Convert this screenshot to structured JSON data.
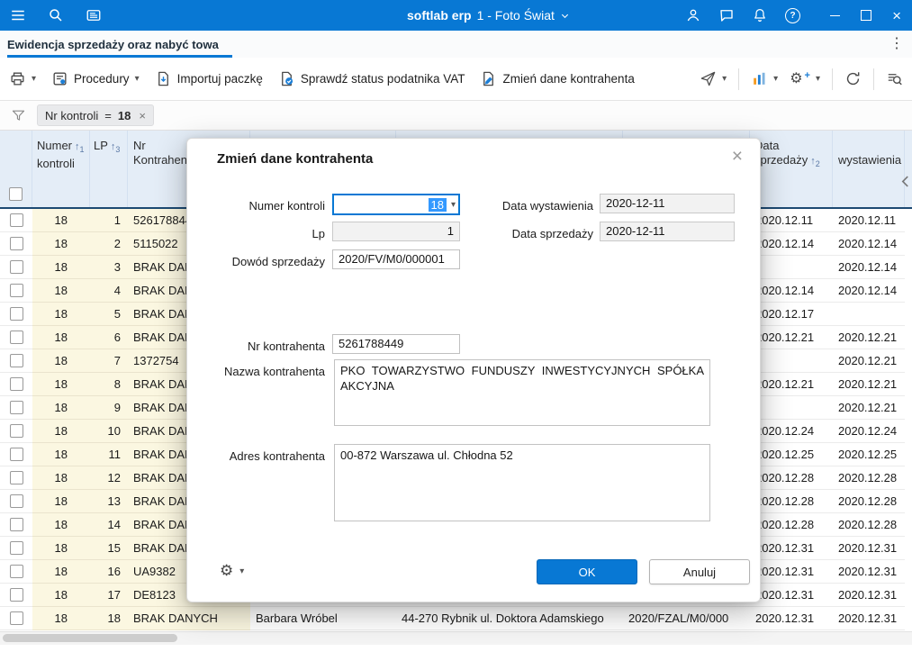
{
  "titlebar": {
    "app_bold": "softlab erp",
    "app_rest": "1 - Foto Świat"
  },
  "tabbar": {
    "active_label": "Ewidencja sprzedaży oraz nabyć towa"
  },
  "toolbar": {
    "procedury": "Procedury",
    "importuj": "Importuj paczkę",
    "sprawdz": "Sprawdź status podatnika VAT",
    "zmien": "Zmień dane kontrahenta"
  },
  "filterbar": {
    "field": "Nr kontroli",
    "operator": "=",
    "value": "18"
  },
  "table": {
    "headers": {
      "numer_line1": "Numer",
      "numer_line2": "kontroli",
      "numer_sort": "1",
      "lp": "LP",
      "lp_sort": "3",
      "nr_line1": "Nr",
      "nr_line2": "Kontrahenta",
      "sprzedazy_line1": "Data",
      "sprzedazy_line2": "sprzedaży",
      "sprzedazy_sort": "2",
      "wystawienia": "wystawienia"
    },
    "rows": [
      {
        "kontroli": "18",
        "lp": "1",
        "nr": "5261788449",
        "nazwa": "",
        "adres": "",
        "dowod": "",
        "ds": "2020.12.11",
        "dw": "2020.12.11"
      },
      {
        "kontroli": "18",
        "lp": "2",
        "nr": "5115022",
        "nazwa": "",
        "adres": "",
        "dowod": "",
        "ds": "2020.12.14",
        "dw": "2020.12.14"
      },
      {
        "kontroli": "18",
        "lp": "3",
        "nr": "BRAK DANYCH",
        "nazwa": "",
        "adres": "",
        "dowod": "",
        "ds": "",
        "dw": "2020.12.14"
      },
      {
        "kontroli": "18",
        "lp": "4",
        "nr": "BRAK DANYCH",
        "nazwa": "",
        "adres": "",
        "dowod": "",
        "ds": "2020.12.14",
        "dw": "2020.12.14"
      },
      {
        "kontroli": "18",
        "lp": "5",
        "nr": "BRAK DANYCH",
        "nazwa": "",
        "adres": "",
        "dowod": "",
        "ds": "2020.12.17",
        "dw": ""
      },
      {
        "kontroli": "18",
        "lp": "6",
        "nr": "BRAK DANYCH",
        "nazwa": "",
        "adres": "",
        "dowod": "",
        "ds": "2020.12.21",
        "dw": "2020.12.21"
      },
      {
        "kontroli": "18",
        "lp": "7",
        "nr": "1372754",
        "nazwa": "",
        "adres": "",
        "dowod": "",
        "ds": "",
        "dw": "2020.12.21"
      },
      {
        "kontroli": "18",
        "lp": "8",
        "nr": "BRAK DANYCH",
        "nazwa": "",
        "adres": "",
        "dowod": "",
        "ds": "2020.12.21",
        "dw": "2020.12.21"
      },
      {
        "kontroli": "18",
        "lp": "9",
        "nr": "BRAK DANYCH",
        "nazwa": "",
        "adres": "",
        "dowod": "",
        "ds": "",
        "dw": "2020.12.21"
      },
      {
        "kontroli": "18",
        "lp": "10",
        "nr": "BRAK DANYCH",
        "nazwa": "",
        "adres": "",
        "dowod": "",
        "ds": "2020.12.24",
        "dw": "2020.12.24"
      },
      {
        "kontroli": "18",
        "lp": "11",
        "nr": "BRAK DANYCH",
        "nazwa": "",
        "adres": "",
        "dowod": "",
        "ds": "2020.12.25",
        "dw": "2020.12.25"
      },
      {
        "kontroli": "18",
        "lp": "12",
        "nr": "BRAK DANYCH",
        "nazwa": "",
        "adres": "",
        "dowod": "",
        "ds": "2020.12.28",
        "dw": "2020.12.28"
      },
      {
        "kontroli": "18",
        "lp": "13",
        "nr": "BRAK DANYCH",
        "nazwa": "",
        "adres": "",
        "dowod": "",
        "ds": "2020.12.28",
        "dw": "2020.12.28"
      },
      {
        "kontroli": "18",
        "lp": "14",
        "nr": "BRAK DANYCH",
        "nazwa": "",
        "adres": "",
        "dowod": "",
        "ds": "2020.12.28",
        "dw": "2020.12.28"
      },
      {
        "kontroli": "18",
        "lp": "15",
        "nr": "BRAK DANYCH",
        "nazwa": "",
        "adres": "",
        "dowod": "",
        "ds": "2020.12.31",
        "dw": "2020.12.31"
      },
      {
        "kontroli": "18",
        "lp": "16",
        "nr": "UA9382",
        "nazwa": "",
        "adres": "",
        "dowod": "",
        "ds": "2020.12.31",
        "dw": "2020.12.31"
      },
      {
        "kontroli": "18",
        "lp": "17",
        "nr": "DE8123",
        "nazwa": "",
        "adres": "",
        "dowod": "",
        "ds": "2020.12.31",
        "dw": "2020.12.31"
      },
      {
        "kontroli": "18",
        "lp": "18",
        "nr": "BRAK DANYCH",
        "nazwa": "Barbara Wróbel",
        "adres": "44-270  Rybnik ul. Doktora Adamskiego",
        "dowod": "2020/FZAL/M0/000",
        "ds": "2020.12.31",
        "dw": "2020.12.31"
      }
    ]
  },
  "dialog": {
    "title": "Zmień dane kontrahenta",
    "fields": {
      "numer_kontroli": {
        "label": "Numer kontroli",
        "value": "18"
      },
      "data_wystawienia": {
        "label": "Data wystawienia",
        "value": "2020-12-11"
      },
      "lp": {
        "label": "Lp",
        "value": "1"
      },
      "data_sprzedazy": {
        "label": "Data sprzedaży",
        "value": "2020-12-11"
      },
      "dowod_sprzedazy": {
        "label": "Dowód sprzedaży",
        "value": "2020/FV/M0/000001"
      },
      "nr_kontrahenta": {
        "label": "Nr kontrahenta",
        "value": "5261788449"
      },
      "nazwa_kontrahenta": {
        "label": "Nazwa kontrahenta",
        "value": "PKO TOWARZYSTWO FUNDUSZY INWESTYCYJNYCH SPÓŁKA AKCYJNA"
      },
      "adres_kontrahenta": {
        "label": "Adres kontrahenta",
        "value": "00-872 Warszawa ul. Chłodna 52"
      }
    },
    "buttons": {
      "ok": "OK",
      "cancel": "Anuluj"
    }
  },
  "colors": {
    "titlebar_bg": "#0878d4",
    "accent": "#0878d4",
    "selection": "#3399ff",
    "sorted_column_bg": "#fbf7e1",
    "header_bg": "#e4edf7",
    "header_border": "#1d4a73"
  }
}
